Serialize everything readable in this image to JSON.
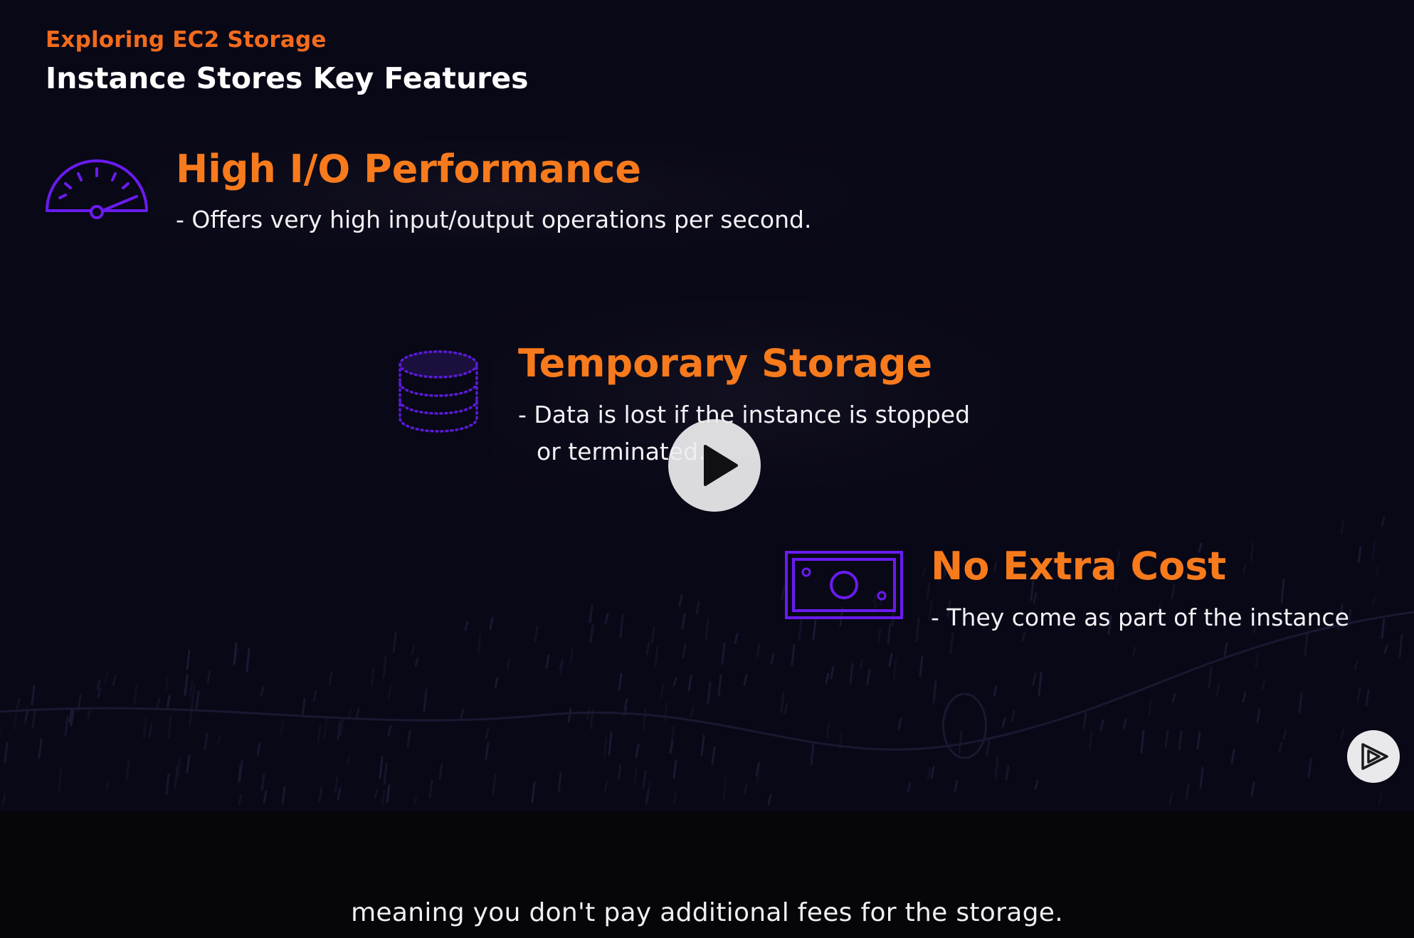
{
  "slide": {
    "eyebrow": "Exploring EC2 Storage",
    "title": "Instance Stores Key Features",
    "features": [
      {
        "title": "High I/O Performance",
        "desc": [
          "- Offers very high input/output operations per second."
        ],
        "icon": "speedometer-icon"
      },
      {
        "title": "Temporary Storage",
        "desc": [
          "- Data is lost if the instance is stopped",
          "or terminated."
        ],
        "icon": "database-icon"
      },
      {
        "title": "No Extra Cost",
        "desc": [
          "- They come as part of the instance"
        ],
        "icon": "money-bill-icon"
      }
    ]
  },
  "player": {
    "play_icon": "play-icon",
    "brand_icon": "pluralsight-logo-icon"
  },
  "caption": {
    "text": "meaning you don't pay additional fees for the storage."
  },
  "colors": {
    "accent_orange": "#f77a1c",
    "icon_purple": "#6a1bf0",
    "background": "#090817"
  }
}
